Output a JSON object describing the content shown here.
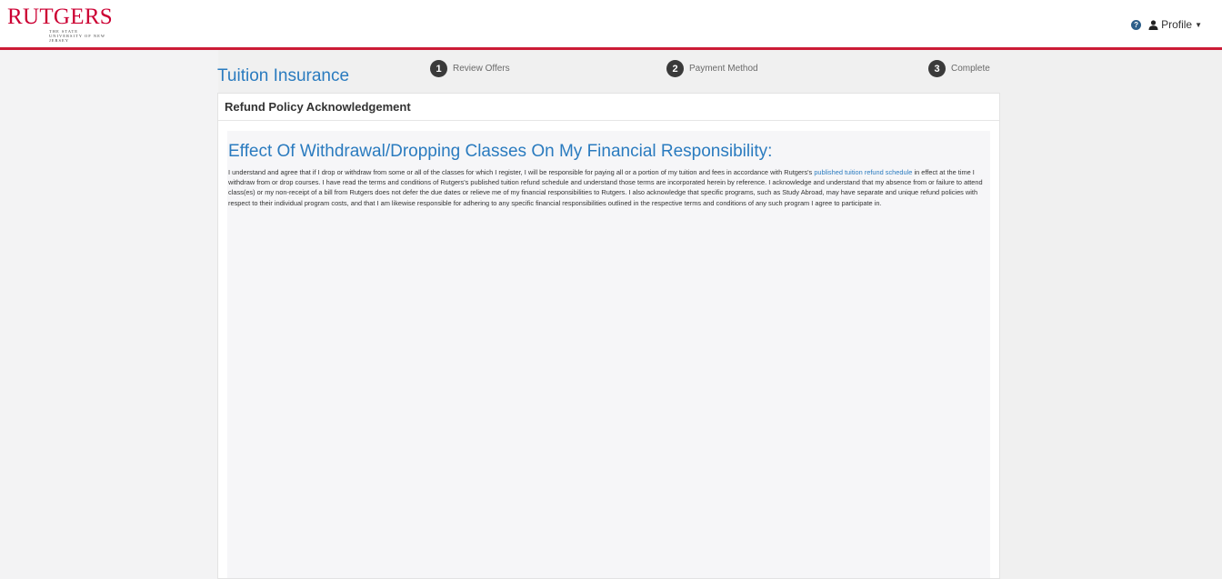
{
  "header": {
    "logo_text": "RUTGERS",
    "logo_subtext": "THE STATE UNIVERSITY OF NEW JERSEY",
    "profile_label": "Profile",
    "help_icon": "question-circle-icon",
    "user_icon": "user-icon",
    "brand_color": "#cc1b36"
  },
  "page": {
    "title": "Tuition Insurance"
  },
  "steps": [
    {
      "number": "1",
      "label": "Review Offers"
    },
    {
      "number": "2",
      "label": "Payment Method"
    },
    {
      "number": "3",
      "label": "Complete"
    }
  ],
  "panel": {
    "header": "Refund Policy Acknowledgement",
    "heading": "Effect Of Withdrawal/Dropping Classes On My Financial Responsibility:",
    "text_before_link": "I understand and agree that if I drop or withdraw from some or all of the classes for which I register, I will be responsible for paying all or a portion of my tuition and fees in accordance with Rutgers's ",
    "link_text": "published tuition refund schedule",
    "text_after_link": " in effect at the time I withdraw from or drop courses. I have read the terms and conditions of Rutgers's published tuition refund schedule and understand those terms are incorporated herein by reference. I acknowledge and understand that my absence from or failure to attend class(es) or my non-receipt of a bill from Rutgers does not defer the due dates or relieve me of my financial responsibilities to Rutgers. I also acknowledge that specific programs, such as Study Abroad, may have separate and unique refund policies with respect to their individual program costs, and that I am likewise responsible for adhering to any specific financial responsibilities outlined in the respective terms and conditions of any such program I agree to participate in."
  },
  "colors": {
    "accent_blue": "#2a7bbf",
    "step_circle": "#3a3a3a"
  }
}
